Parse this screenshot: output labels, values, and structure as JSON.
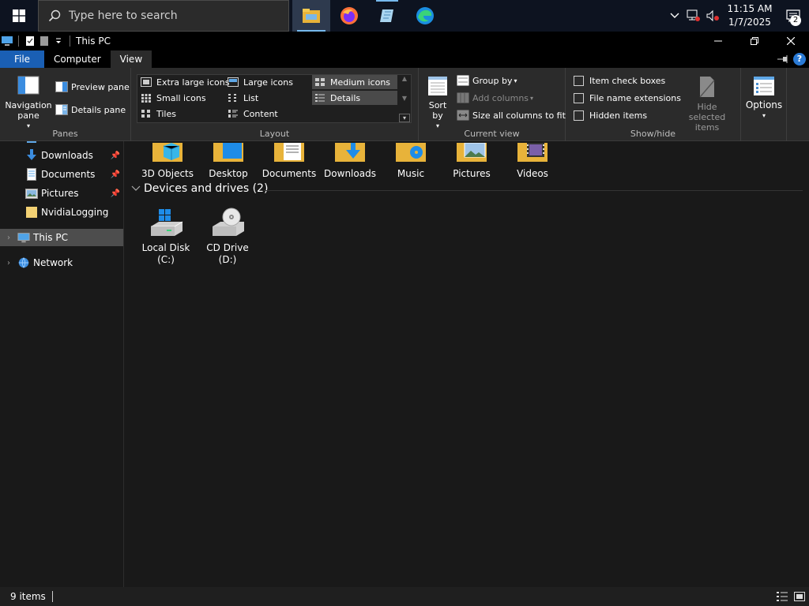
{
  "taskbar": {
    "search_placeholder": "Type here to search",
    "apps": [
      "file-explorer",
      "firefox",
      "notepad",
      "edge"
    ],
    "clock_time": "11:15 AM",
    "clock_date": "1/7/2025",
    "notification_count": "2"
  },
  "window": {
    "title": "This PC"
  },
  "ribbon_tabs": [
    "File",
    "Computer",
    "View"
  ],
  "ribbon": {
    "panes": {
      "navigation_pane": "Navigation pane",
      "preview_pane": "Preview pane",
      "details_pane": "Details pane",
      "label": "Panes"
    },
    "layout": {
      "items": [
        "Extra large icons",
        "Large icons",
        "Medium icons",
        "Small icons",
        "List",
        "Details",
        "Tiles",
        "Content"
      ],
      "label": "Layout"
    },
    "current_view": {
      "sort_by": "Sort by",
      "group_by": "Group by",
      "add_columns": "Add columns",
      "size_columns": "Size all columns to fit",
      "label": "Current view"
    },
    "show_hide": {
      "item_check_boxes": "Item check boxes",
      "file_name_extensions": "File name extensions",
      "hidden_items": "Hidden items",
      "hide_selected": "Hide selected items",
      "label": "Show/hide"
    },
    "options": "Options"
  },
  "nav": {
    "items": [
      "Downloads",
      "Documents",
      "Pictures",
      "NvidiaLogging",
      "This PC",
      "Network"
    ]
  },
  "content": {
    "folders": [
      "3D Objects",
      "Desktop",
      "Documents",
      "Downloads",
      "Music",
      "Pictures",
      "Videos"
    ],
    "devices_header": "Devices and drives (2)",
    "drives": [
      {
        "name": "Local Disk",
        "letter": "(C:)"
      },
      {
        "name": "CD Drive",
        "letter": "(D:)"
      }
    ]
  },
  "status": {
    "items": "9 items"
  },
  "colors": {
    "accent": "#1a5fb4",
    "folder": "#f3c950",
    "background": "#191919"
  }
}
